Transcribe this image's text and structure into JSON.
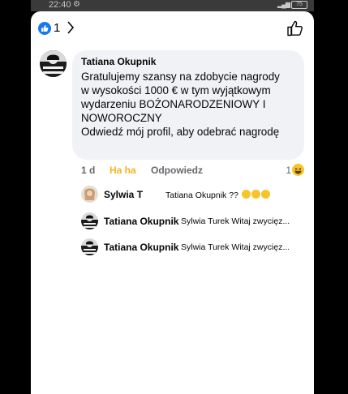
{
  "status": {
    "time": "22:40",
    "battery": "75"
  },
  "header": {
    "like_count": "1"
  },
  "comment": {
    "author": "Tatiana Okupnik",
    "text": "Gratulujemy szansy na zdobycie nagrody\nw wysokości 1000 € w tym wyjątkowym\nwydarzeniu BOŻONARODZENIOWY I\nNOWOROCZNY\nOdwiedź mój profil, aby odebrać nagrodę",
    "time": "1 d",
    "reaction_label": "Ha ha",
    "reply_label": "Odpowiedz",
    "reaction_count": "1"
  },
  "replies": [
    {
      "author": "Sylwia T",
      "text": "Tatiana Okupnik ??"
    },
    {
      "author": "Tatiana Okupnik",
      "text": "Sylwia Turek Witaj zwycięz..."
    },
    {
      "author": "Tatiana Okupnik",
      "text": "Sylwia Turek Witaj zwycięz..."
    }
  ],
  "colors": {
    "facebook_blue": "#1877f2",
    "haha_yellow": "#f7b125",
    "bubble_gray": "#f0f2f5"
  },
  "icons": [
    "settings-gear-icon",
    "signal-icon",
    "battery-icon",
    "like-thumb-icon",
    "chevron-right-icon",
    "thumb-outline-icon",
    "haha-emoji-icon",
    "laughing-emoji-icon"
  ]
}
